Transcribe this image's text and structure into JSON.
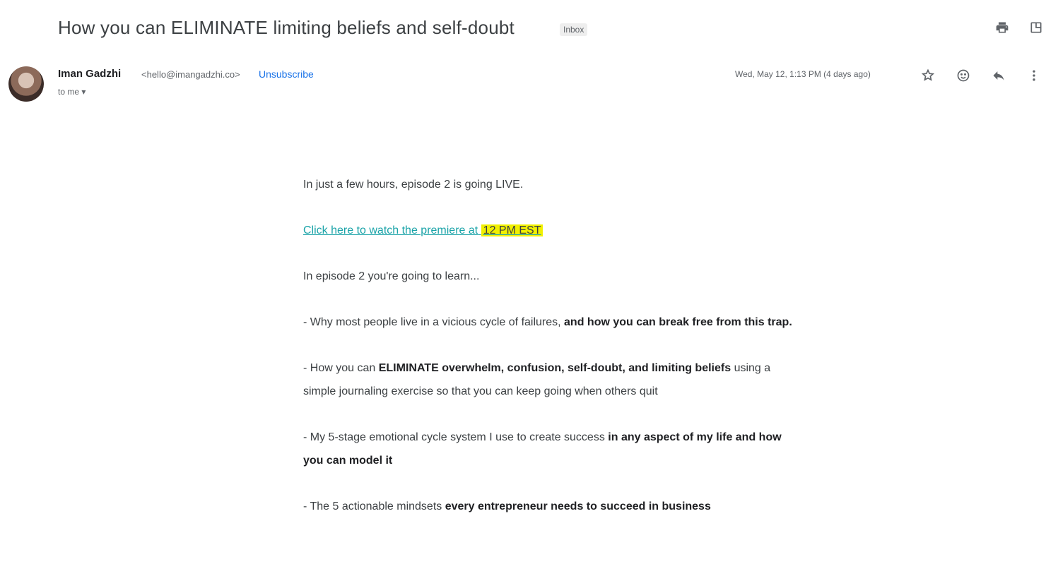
{
  "email": {
    "subject": "How you can ELIMINATE limiting beliefs and self-doubt",
    "label": "Inbox",
    "sender": {
      "name": "Iman Gadzhi",
      "email": "<hello@imangadzhi.co>",
      "unsubscribe_label": "Unsubscribe",
      "to_line": "to me ▾"
    },
    "date": "Wed, May 12, 1:13 PM (4 days ago)",
    "body": {
      "intro": "In just a few hours, episode 2 is going LIVE.",
      "link_text": "Click here to watch the premiere at",
      "link_time": "12 PM EST",
      "lead_in": "In episode 2 you're going to learn...",
      "b1_plain_start": "- Why most people live in a vicious cycle of failures, ",
      "b1_bold": "and how you can break free from this trap.",
      "b2_plain_start": "- How you can ",
      "b2_bold": "ELIMINATE overwhelm, confusion, self-doubt, and limiting beliefs",
      "b2_plain_end": " using a simple journaling exercise so that you can keep going when others quit",
      "b3_plain_start": "- My 5-stage emotional cycle system I use to create success ",
      "b3_bold": "in any aspect of my life and how you can model it",
      "b4_plain_start": "- The 5 actionable mindsets ",
      "b4_bold": "every entrepreneur needs to succeed in business"
    }
  },
  "icons": {
    "print": "print-icon",
    "new_window": "open-in-new-window-icon",
    "star": "star-icon",
    "emoji": "emoji-reaction-icon",
    "reply": "reply-icon",
    "more": "more-vert-icon"
  }
}
